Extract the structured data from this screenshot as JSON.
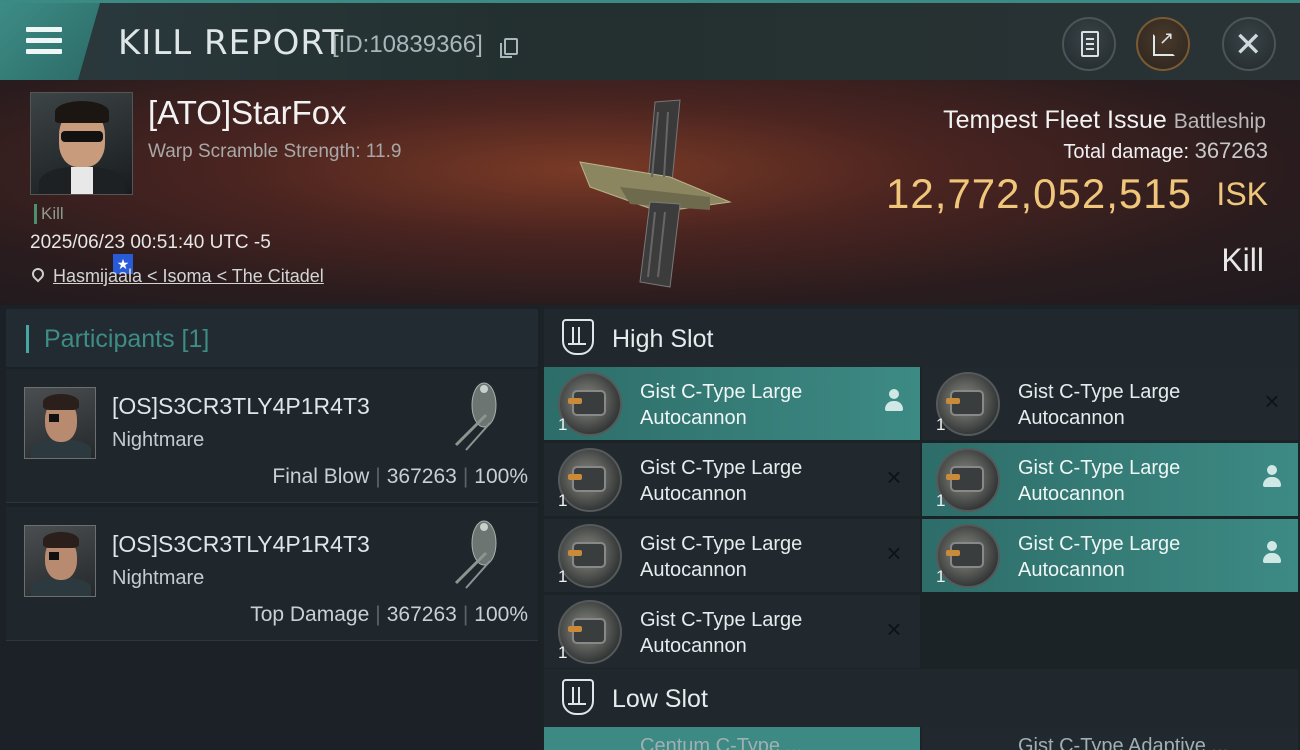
{
  "header": {
    "title": "KILL REPORT",
    "report_id": "[ID:10839366]",
    "icons": [
      "menu-icon",
      "copy-icon",
      "clipboard-icon",
      "share-icon",
      "close-icon"
    ]
  },
  "victim": {
    "pilot": "[ATO]StarFox",
    "warp_info": "Warp Scramble Strength: 11.9",
    "tag": "Kill",
    "time": "2025/06/23 00:51:40 UTC -5",
    "location": "Hasmijaala < Isoma < The Citadel",
    "ship_name": "Tempest Fleet Issue",
    "ship_class": "Battleship",
    "total_damage_label": "Total damage:",
    "total_damage": "367263",
    "isk_value": "12,772,052,515",
    "isk_unit": "ISK",
    "result": "Kill"
  },
  "participants": {
    "title": "Participants [1]",
    "items": [
      {
        "name": "[OS]S3CR3TLY4P1R4T3",
        "ship": "Nightmare",
        "role": "Final Blow",
        "damage": "367263",
        "percent": "100%"
      },
      {
        "name": "[OS]S3CR3TLY4P1R4T3",
        "ship": "Nightmare",
        "role": "Top Damage",
        "damage": "367263",
        "percent": "100%"
      }
    ]
  },
  "slots": {
    "high_title": "High Slot",
    "low_title": "Low Slot",
    "high_modules": [
      {
        "qty": "1",
        "name_line1": "Gist C-Type Large",
        "name_line2": "Autocannon",
        "status": "dropped",
        "status_icon": "person-icon"
      },
      {
        "qty": "1",
        "name_line1": "Gist C-Type Large",
        "name_line2": "Autocannon",
        "status": "destroyed",
        "status_icon": "×"
      },
      {
        "qty": "1",
        "name_line1": "Gist C-Type Large",
        "name_line2": "Autocannon",
        "status": "destroyed",
        "status_icon": "×"
      },
      {
        "qty": "1",
        "name_line1": "Gist C-Type Large",
        "name_line2": "Autocannon",
        "status": "dropped",
        "status_icon": "person-icon"
      },
      {
        "qty": "1",
        "name_line1": "Gist C-Type Large",
        "name_line2": "Autocannon",
        "status": "destroyed",
        "status_icon": "×"
      },
      {
        "qty": "1",
        "name_line1": "Gist C-Type Large",
        "name_line2": "Autocannon",
        "status": "dropped",
        "status_icon": "person-icon"
      },
      {
        "qty": "1",
        "name_line1": "Gist C-Type Large",
        "name_line2": "Autocannon",
        "status": "destroyed",
        "status_icon": "×"
      }
    ],
    "low_peek": [
      "Centum C-Type ...",
      "Gist C-Type Adaptive ..."
    ]
  },
  "colors": {
    "accent": "#3d8a84",
    "isk": "#f0c67b"
  }
}
